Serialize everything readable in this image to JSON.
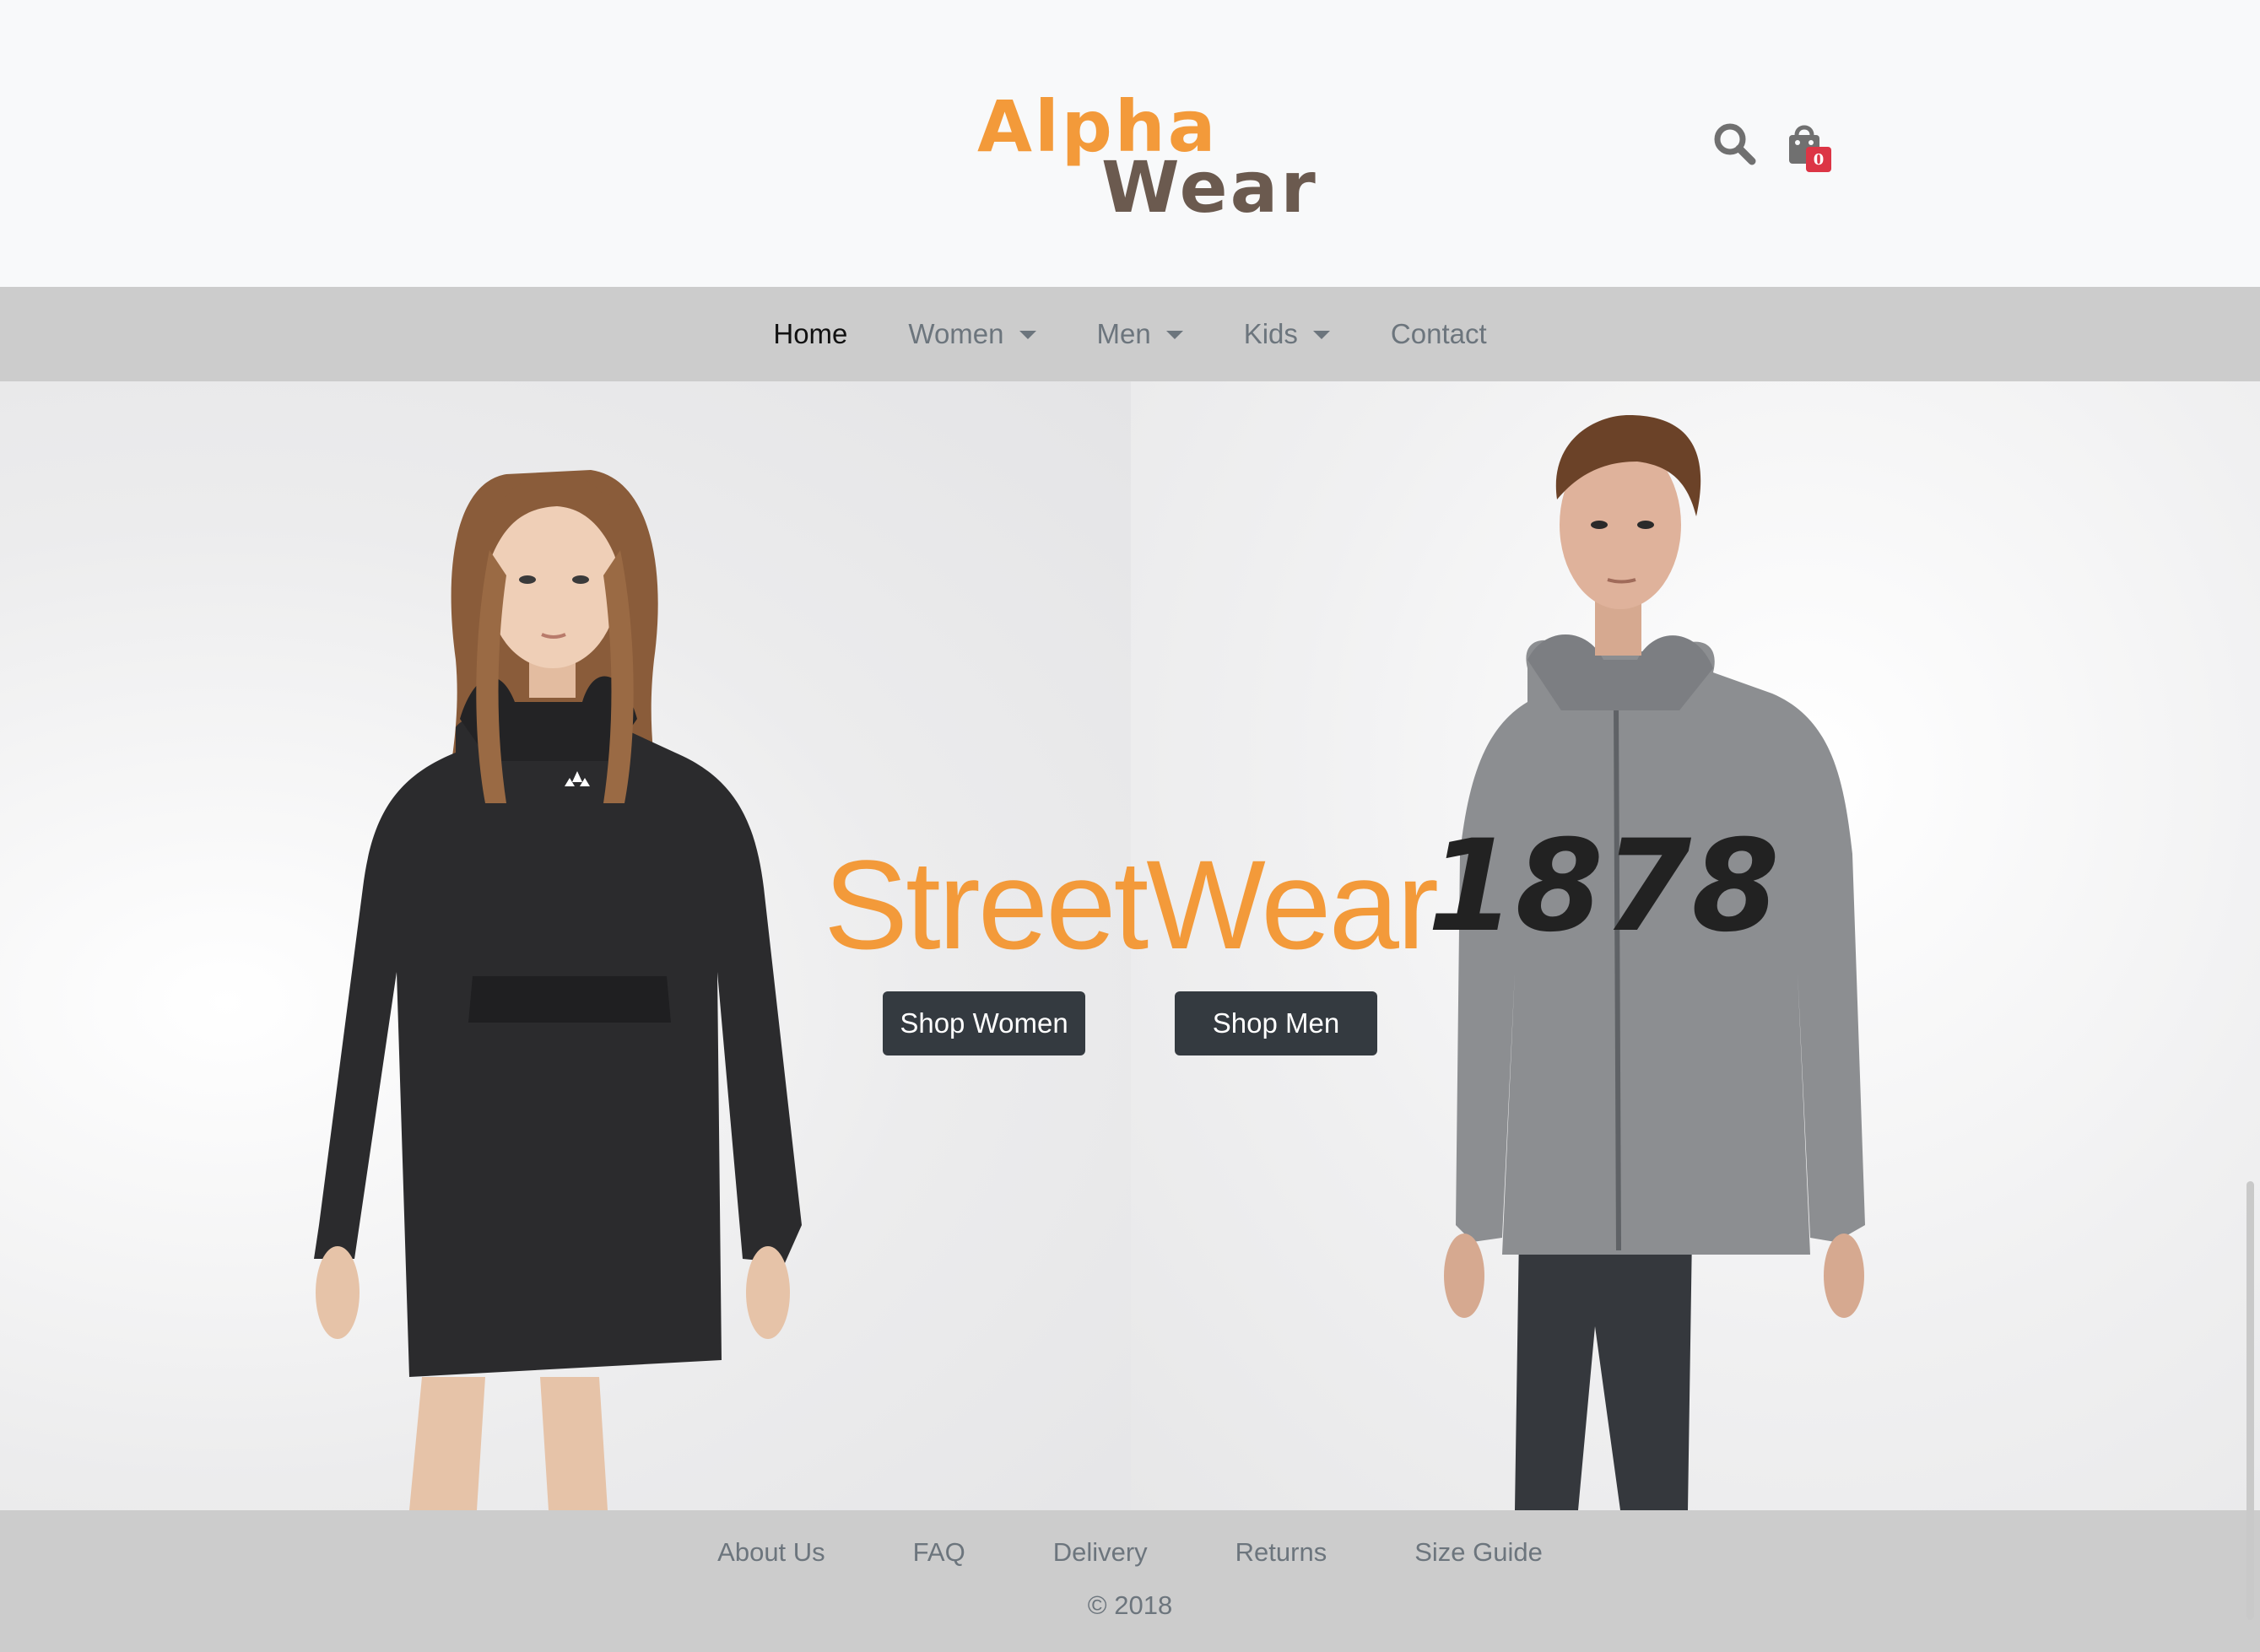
{
  "colors": {
    "brand": "#f39a3a",
    "brand2": "#6b5a4f",
    "nav_bg": "#cccccc",
    "button_bg": "#343a40",
    "badge_bg": "#dc3545"
  },
  "logo": {
    "line1": "Alpha",
    "line2": "Wear"
  },
  "header": {
    "search_icon": "search-icon",
    "cart_icon": "shopping-bag-icon",
    "cart_count": "0"
  },
  "nav": {
    "items": [
      {
        "label": "Home",
        "active": true,
        "dropdown": false
      },
      {
        "label": "Women",
        "active": false,
        "dropdown": true
      },
      {
        "label": "Men",
        "active": false,
        "dropdown": true
      },
      {
        "label": "Kids",
        "active": false,
        "dropdown": true
      },
      {
        "label": "Contact",
        "active": false,
        "dropdown": false
      }
    ]
  },
  "hero": {
    "title": "StreetWear",
    "buttons": {
      "women": "Shop Women",
      "men": "Shop Men"
    },
    "jacket_number": "1878"
  },
  "footer": {
    "links": [
      "About Us",
      "FAQ",
      "Delivery",
      "Returns",
      "Size Guide"
    ],
    "copyright": "© 2018"
  }
}
